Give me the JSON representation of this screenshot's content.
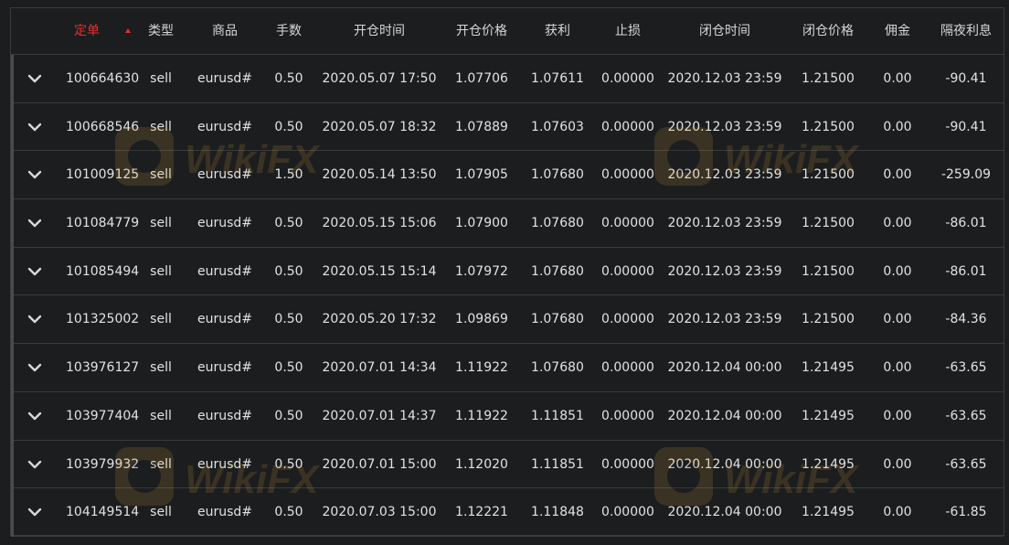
{
  "columns": [
    {
      "key": "order",
      "label": "定单",
      "active": true
    },
    {
      "key": "type",
      "label": "类型"
    },
    {
      "key": "symbol",
      "label": "商品"
    },
    {
      "key": "lots",
      "label": "手数"
    },
    {
      "key": "open_time",
      "label": "开仓时间"
    },
    {
      "key": "open_price",
      "label": "开仓价格"
    },
    {
      "key": "take_profit",
      "label": "获利"
    },
    {
      "key": "stop_loss",
      "label": "止损"
    },
    {
      "key": "close_time",
      "label": "闭仓时间"
    },
    {
      "key": "close_price",
      "label": "闭仓价格"
    },
    {
      "key": "commission",
      "label": "佣金"
    },
    {
      "key": "swap",
      "label": "隔夜利息"
    }
  ],
  "rows": [
    {
      "order": "100664630",
      "type": "sell",
      "symbol": "eurusd#",
      "lots": "0.50",
      "open_time": "2020.05.07 17:50",
      "open_price": "1.07706",
      "take_profit": "1.07611",
      "stop_loss": "0.00000",
      "close_time": "2020.12.03 23:59",
      "close_price": "1.21500",
      "commission": "0.00",
      "swap": "-90.41"
    },
    {
      "order": "100668546",
      "type": "sell",
      "symbol": "eurusd#",
      "lots": "0.50",
      "open_time": "2020.05.07 18:32",
      "open_price": "1.07889",
      "take_profit": "1.07603",
      "stop_loss": "0.00000",
      "close_time": "2020.12.03 23:59",
      "close_price": "1.21500",
      "commission": "0.00",
      "swap": "-90.41"
    },
    {
      "order": "101009125",
      "type": "sell",
      "symbol": "eurusd#",
      "lots": "1.50",
      "open_time": "2020.05.14 13:50",
      "open_price": "1.07905",
      "take_profit": "1.07680",
      "stop_loss": "0.00000",
      "close_time": "2020.12.03 23:59",
      "close_price": "1.21500",
      "commission": "0.00",
      "swap": "-259.09"
    },
    {
      "order": "101084779",
      "type": "sell",
      "symbol": "eurusd#",
      "lots": "0.50",
      "open_time": "2020.05.15 15:06",
      "open_price": "1.07900",
      "take_profit": "1.07680",
      "stop_loss": "0.00000",
      "close_time": "2020.12.03 23:59",
      "close_price": "1.21500",
      "commission": "0.00",
      "swap": "-86.01"
    },
    {
      "order": "101085494",
      "type": "sell",
      "symbol": "eurusd#",
      "lots": "0.50",
      "open_time": "2020.05.15 15:14",
      "open_price": "1.07972",
      "take_profit": "1.07680",
      "stop_loss": "0.00000",
      "close_time": "2020.12.03 23:59",
      "close_price": "1.21500",
      "commission": "0.00",
      "swap": "-86.01"
    },
    {
      "order": "101325002",
      "type": "sell",
      "symbol": "eurusd#",
      "lots": "0.50",
      "open_time": "2020.05.20 17:32",
      "open_price": "1.09869",
      "take_profit": "1.07680",
      "stop_loss": "0.00000",
      "close_time": "2020.12.03 23:59",
      "close_price": "1.21500",
      "commission": "0.00",
      "swap": "-84.36"
    },
    {
      "order": "103976127",
      "type": "sell",
      "symbol": "eurusd#",
      "lots": "0.50",
      "open_time": "2020.07.01 14:34",
      "open_price": "1.11922",
      "take_profit": "1.07680",
      "stop_loss": "0.00000",
      "close_time": "2020.12.04 00:00",
      "close_price": "1.21495",
      "commission": "0.00",
      "swap": "-63.65"
    },
    {
      "order": "103977404",
      "type": "sell",
      "symbol": "eurusd#",
      "lots": "0.50",
      "open_time": "2020.07.01 14:37",
      "open_price": "1.11922",
      "take_profit": "1.11851",
      "stop_loss": "0.00000",
      "close_time": "2020.12.04 00:00",
      "close_price": "1.21495",
      "commission": "0.00",
      "swap": "-63.65"
    },
    {
      "order": "103979932",
      "type": "sell",
      "symbol": "eurusd#",
      "lots": "0.50",
      "open_time": "2020.07.01 15:00",
      "open_price": "1.12020",
      "take_profit": "1.11851",
      "stop_loss": "0.00000",
      "close_time": "2020.12.04 00:00",
      "close_price": "1.21495",
      "commission": "0.00",
      "swap": "-63.65"
    },
    {
      "order": "104149514",
      "type": "sell",
      "symbol": "eurusd#",
      "lots": "0.50",
      "open_time": "2020.07.03 15:00",
      "open_price": "1.12221",
      "take_profit": "1.11848",
      "stop_loss": "0.00000",
      "close_time": "2020.12.04 00:00",
      "close_price": "1.21495",
      "commission": "0.00",
      "swap": "-61.85"
    }
  ],
  "icons": {
    "sort": "sort-asc-icon",
    "expand": "chevron-down-icon"
  },
  "watermark": {
    "text": "WikiFX"
  },
  "colors": {
    "background": "#1c1d1f",
    "border": "#3a3b3e",
    "accent": "#e0312b",
    "text": "#e2e2e2"
  }
}
